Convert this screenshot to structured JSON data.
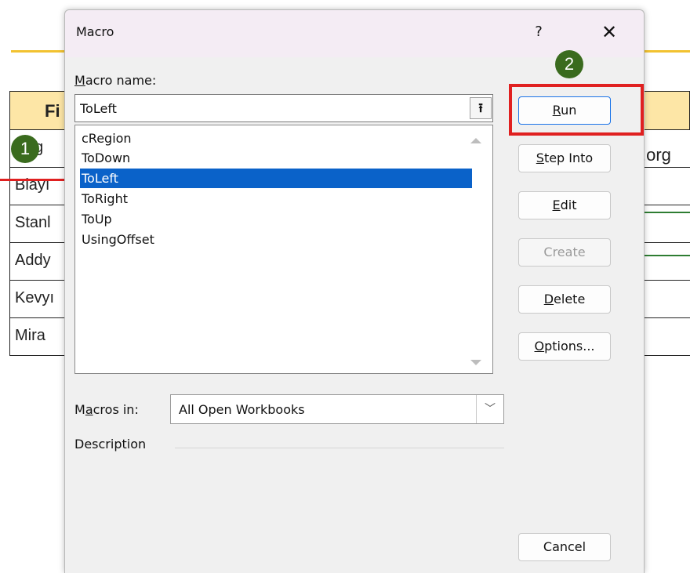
{
  "background": {
    "header_text": "Fi",
    "rows": [
      "ng",
      "Blayı",
      "Stanl",
      "Addy",
      "Kevyı",
      "Mira"
    ],
    "right_text": ".org",
    "badges": [
      "1",
      "2"
    ]
  },
  "dialog": {
    "title": "Macro",
    "help_label": "?",
    "close_label": "✕",
    "macro_name_label_accel": "M",
    "macro_name_label_rest": "acro name:",
    "macro_name_value": "ToLeft",
    "upload_glyph": "⭱",
    "macros": [
      "cRegion",
      "ToDown",
      "ToLeft",
      "ToRight",
      "ToUp",
      "UsingOffset"
    ],
    "selected_macro": "ToLeft",
    "buttons": {
      "run": {
        "accel": "R",
        "rest": "un"
      },
      "step_into": {
        "accel": "S",
        "rest": "tep Into"
      },
      "edit": {
        "accel": "E",
        "rest": "dit"
      },
      "create": {
        "label": "Create"
      },
      "delete": {
        "accel": "D",
        "rest": "elete"
      },
      "options": {
        "accel": "O",
        "rest": "ptions..."
      },
      "cancel": {
        "label": "Cancel"
      }
    },
    "macros_in_label_pre": "M",
    "macros_in_label_accel": "a",
    "macros_in_label_rest": "cros in:",
    "macros_in_value": "All Open Workbooks",
    "dropdown_glyph": "﹀",
    "description_label": "Description"
  },
  "colors": {
    "selection": "#0a62c9",
    "badge_green": "#3a6b1e",
    "highlight_red": "#e02020",
    "header_fill": "#fde6a6",
    "accent_line": "#f2c230"
  }
}
